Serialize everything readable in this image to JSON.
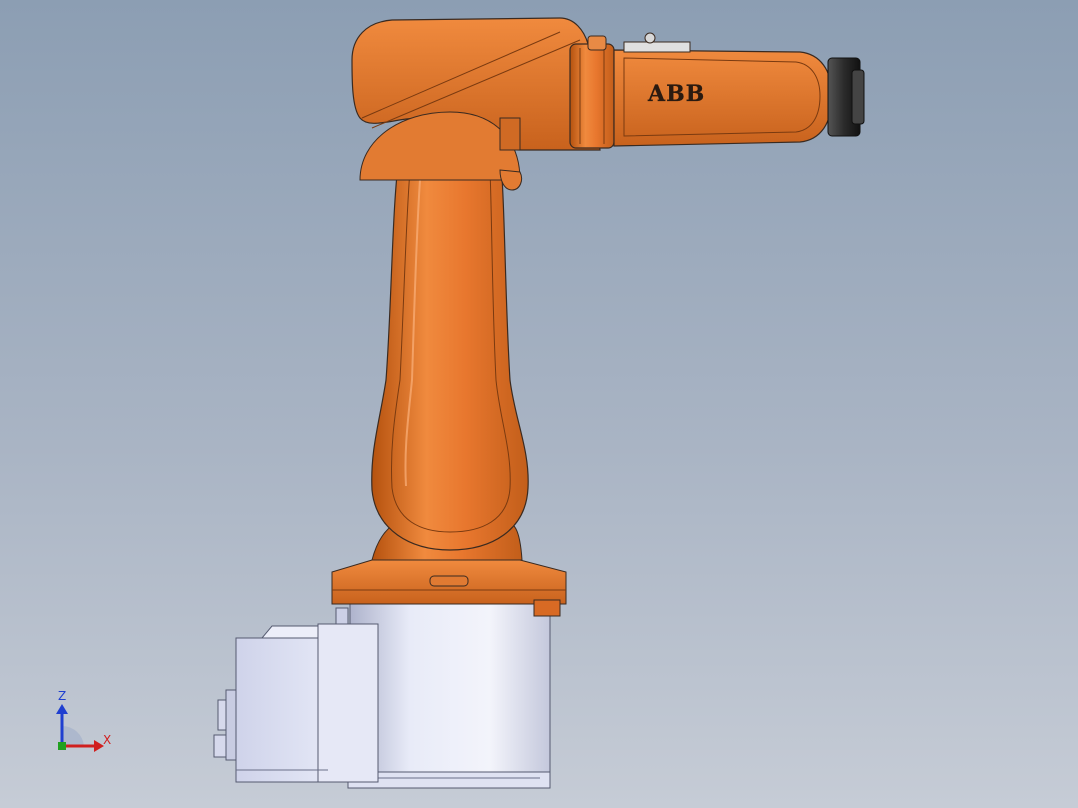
{
  "model": {
    "brand_logo": "ABB",
    "colors": {
      "robot_orange": "#e8772e",
      "robot_orange_dark": "#b5520f",
      "robot_orange_light": "#f79a52",
      "base_gray": "#dde1f2",
      "base_gray_dark": "#9ea3bd",
      "flange_black": "#2b2b2b",
      "outline": "#3a2a20"
    }
  },
  "triad": {
    "z_label": "Z",
    "x_label": "X",
    "z_color": "#1f3fd0",
    "x_color": "#d01f1f",
    "y_color": "#20a020"
  }
}
